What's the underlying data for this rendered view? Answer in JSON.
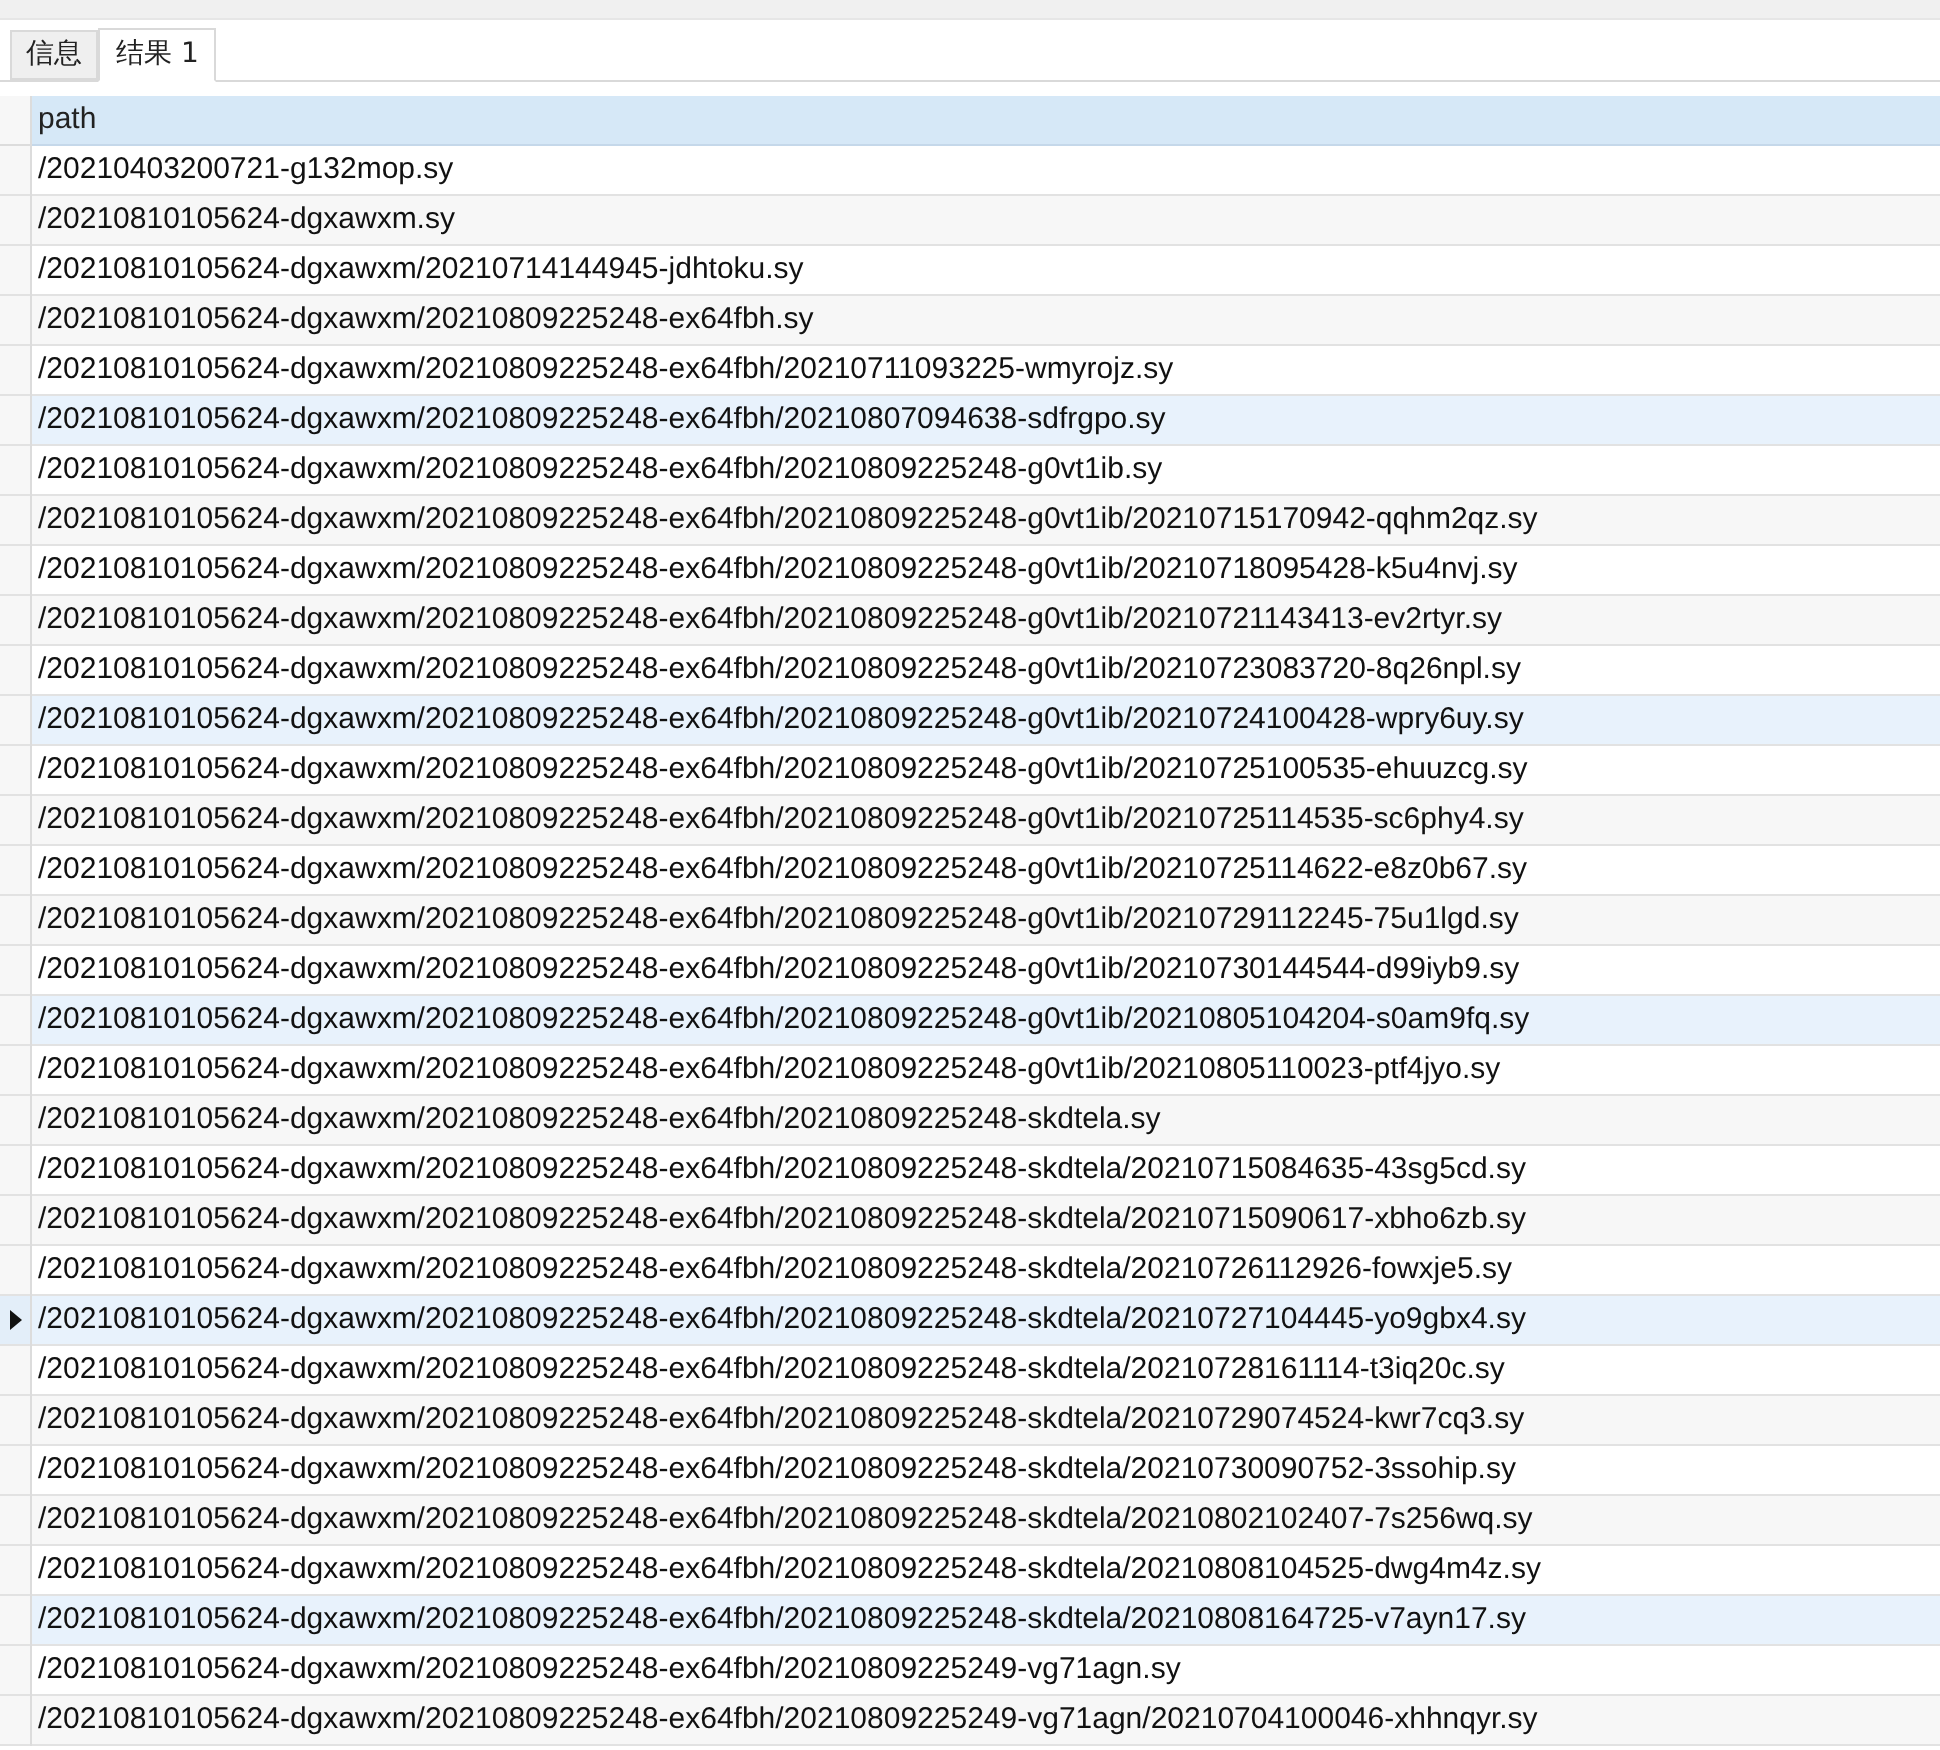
{
  "tabs": [
    {
      "label": "信息",
      "selected": false
    },
    {
      "label": "结果 1",
      "selected": true
    }
  ],
  "table": {
    "columns": [
      "path"
    ],
    "rows": [
      {
        "path": "/20210403200721-g132mop.sy",
        "selected": false,
        "highlighted": false
      },
      {
        "path": "/20210810105624-dgxawxm.sy",
        "selected": false,
        "highlighted": false
      },
      {
        "path": "/20210810105624-dgxawxm/20210714144945-jdhtoku.sy",
        "selected": false,
        "highlighted": false
      },
      {
        "path": "/20210810105624-dgxawxm/20210809225248-ex64fbh.sy",
        "selected": false,
        "highlighted": false
      },
      {
        "path": "/20210810105624-dgxawxm/20210809225248-ex64fbh/20210711093225-wmyrojz.sy",
        "selected": false,
        "highlighted": false
      },
      {
        "path": "/20210810105624-dgxawxm/20210809225248-ex64fbh/20210807094638-sdfrgpo.sy",
        "selected": false,
        "highlighted": true
      },
      {
        "path": "/20210810105624-dgxawxm/20210809225248-ex64fbh/20210809225248-g0vt1ib.sy",
        "selected": false,
        "highlighted": false
      },
      {
        "path": "/20210810105624-dgxawxm/20210809225248-ex64fbh/20210809225248-g0vt1ib/20210715170942-qqhm2qz.sy",
        "selected": false,
        "highlighted": false
      },
      {
        "path": "/20210810105624-dgxawxm/20210809225248-ex64fbh/20210809225248-g0vt1ib/20210718095428-k5u4nvj.sy",
        "selected": false,
        "highlighted": false
      },
      {
        "path": "/20210810105624-dgxawxm/20210809225248-ex64fbh/20210809225248-g0vt1ib/20210721143413-ev2rtyr.sy",
        "selected": false,
        "highlighted": false
      },
      {
        "path": "/20210810105624-dgxawxm/20210809225248-ex64fbh/20210809225248-g0vt1ib/20210723083720-8q26npl.sy",
        "selected": false,
        "highlighted": false
      },
      {
        "path": "/20210810105624-dgxawxm/20210809225248-ex64fbh/20210809225248-g0vt1ib/20210724100428-wpry6uy.sy",
        "selected": false,
        "highlighted": true
      },
      {
        "path": "/20210810105624-dgxawxm/20210809225248-ex64fbh/20210809225248-g0vt1ib/20210725100535-ehuuzcg.sy",
        "selected": false,
        "highlighted": false
      },
      {
        "path": "/20210810105624-dgxawxm/20210809225248-ex64fbh/20210809225248-g0vt1ib/20210725114535-sc6phy4.sy",
        "selected": false,
        "highlighted": false
      },
      {
        "path": "/20210810105624-dgxawxm/20210809225248-ex64fbh/20210809225248-g0vt1ib/20210725114622-e8z0b67.sy",
        "selected": false,
        "highlighted": false
      },
      {
        "path": "/20210810105624-dgxawxm/20210809225248-ex64fbh/20210809225248-g0vt1ib/20210729112245-75u1lgd.sy",
        "selected": false,
        "highlighted": false
      },
      {
        "path": "/20210810105624-dgxawxm/20210809225248-ex64fbh/20210809225248-g0vt1ib/20210730144544-d99iyb9.sy",
        "selected": false,
        "highlighted": false
      },
      {
        "path": "/20210810105624-dgxawxm/20210809225248-ex64fbh/20210809225248-g0vt1ib/20210805104204-s0am9fq.sy",
        "selected": false,
        "highlighted": true
      },
      {
        "path": "/20210810105624-dgxawxm/20210809225248-ex64fbh/20210809225248-g0vt1ib/20210805110023-ptf4jyo.sy",
        "selected": false,
        "highlighted": false
      },
      {
        "path": "/20210810105624-dgxawxm/20210809225248-ex64fbh/20210809225248-skdtela.sy",
        "selected": false,
        "highlighted": false
      },
      {
        "path": "/20210810105624-dgxawxm/20210809225248-ex64fbh/20210809225248-skdtela/20210715084635-43sg5cd.sy",
        "selected": false,
        "highlighted": false
      },
      {
        "path": "/20210810105624-dgxawxm/20210809225248-ex64fbh/20210809225248-skdtela/20210715090617-xbho6zb.sy",
        "selected": false,
        "highlighted": false
      },
      {
        "path": "/20210810105624-dgxawxm/20210809225248-ex64fbh/20210809225248-skdtela/20210726112926-fowxje5.sy",
        "selected": false,
        "highlighted": false
      },
      {
        "path": "/20210810105624-dgxawxm/20210809225248-ex64fbh/20210809225248-skdtela/20210727104445-yo9gbx4.sy",
        "selected": true,
        "highlighted": true
      },
      {
        "path": "/20210810105624-dgxawxm/20210809225248-ex64fbh/20210809225248-skdtela/20210728161114-t3iq20c.sy",
        "selected": false,
        "highlighted": false
      },
      {
        "path": "/20210810105624-dgxawxm/20210809225248-ex64fbh/20210809225248-skdtela/20210729074524-kwr7cq3.sy",
        "selected": false,
        "highlighted": false
      },
      {
        "path": "/20210810105624-dgxawxm/20210809225248-ex64fbh/20210809225248-skdtela/20210730090752-3ssohip.sy",
        "selected": false,
        "highlighted": false
      },
      {
        "path": "/20210810105624-dgxawxm/20210809225248-ex64fbh/20210809225248-skdtela/20210802102407-7s256wq.sy",
        "selected": false,
        "highlighted": false
      },
      {
        "path": "/20210810105624-dgxawxm/20210809225248-ex64fbh/20210809225248-skdtela/20210808104525-dwg4m4z.sy",
        "selected": false,
        "highlighted": false
      },
      {
        "path": "/20210810105624-dgxawxm/20210809225248-ex64fbh/20210809225248-skdtela/20210808164725-v7ayn17.sy",
        "selected": false,
        "highlighted": true
      },
      {
        "path": "/20210810105624-dgxawxm/20210809225248-ex64fbh/20210809225249-vg71agn.sy",
        "selected": false,
        "highlighted": false
      },
      {
        "path": "/20210810105624-dgxawxm/20210809225248-ex64fbh/20210809225249-vg71agn/20210704100046-xhhnqyr.sy",
        "selected": false,
        "highlighted": false
      }
    ]
  }
}
